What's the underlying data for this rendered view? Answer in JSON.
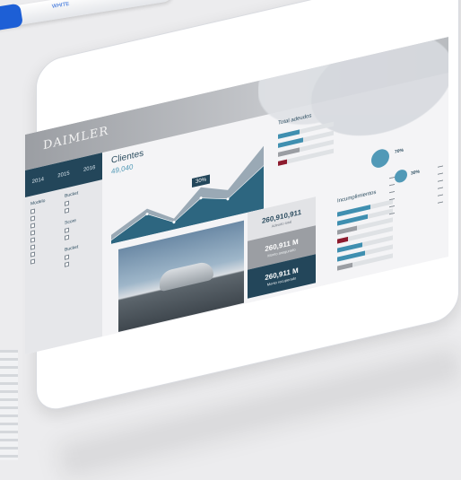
{
  "pen": {
    "label": "WHITE"
  },
  "dashboard": {
    "brand": "DAIMLER",
    "years": [
      "2014",
      "2015",
      "2016"
    ],
    "clientes": {
      "title": "Clientes",
      "value": "49,040",
      "badge": "30%"
    },
    "kpis": [
      {
        "value": "260,910,911",
        "label": "Adeudo total"
      },
      {
        "value": "260,911 M",
        "label": "Monto asegurado"
      },
      {
        "value": "260,911 M",
        "label": "Monto recuperado"
      }
    ],
    "total_adeudos": {
      "title": "Total adeudos",
      "circles": [
        "70%",
        "30%"
      ]
    },
    "incumplimientos": {
      "title": "Incumplimientos"
    },
    "filters": {
      "col1_title": "Modelo",
      "col2_title": "Bucket",
      "col3_title": "Score",
      "col4_title": "Bucket"
    }
  },
  "colors": {
    "accent": "#23465a",
    "teal": "#3f8fb0",
    "red": "#8d1b2e",
    "grey": "#9b9ea3"
  }
}
